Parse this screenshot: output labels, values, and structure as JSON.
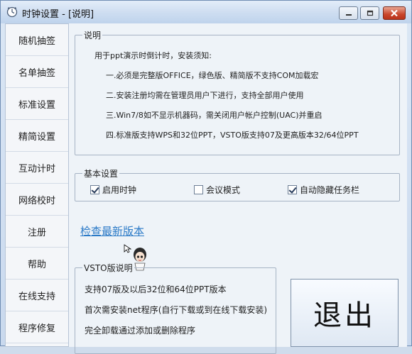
{
  "window": {
    "title": "时钟设置 - [说明]"
  },
  "sidebar": {
    "items": [
      {
        "label": "随机抽签"
      },
      {
        "label": "名单抽签"
      },
      {
        "label": "标准设置"
      },
      {
        "label": "精简设置"
      },
      {
        "label": "互动计时"
      },
      {
        "label": "网络校时"
      },
      {
        "label": "注册"
      },
      {
        "label": "帮助"
      },
      {
        "label": "在线支持"
      },
      {
        "label": "程序修复"
      }
    ]
  },
  "instructions": {
    "title": "说明",
    "intro": "用于ppt演示时倒计时，安装须知:",
    "lines": [
      "一.必须是完整版OFFICE，绿色版、精简版不支持COM加载宏",
      "二.安装注册均需在管理员用户下进行，支持全部用户使用",
      "三.Win7/8如不显示机器码，需关闭用户帐户控制(UAC)并重启",
      "四.标准版支持WPS和32位PPT，VSTO版支持07及更高版本32/64位PPT"
    ]
  },
  "basic_settings": {
    "title": "基本设置",
    "options": [
      {
        "label": "启用时钟",
        "checked": true
      },
      {
        "label": "会议模式",
        "checked": false
      },
      {
        "label": "自动隐藏任务栏",
        "checked": true
      }
    ]
  },
  "update_link": "检查最新版本",
  "vsto": {
    "title": "VSTO版说明",
    "lines": [
      "支持07版及以后32位和64位PPT版本",
      "首次需安装net程序(自行下载或到在线下载安装)",
      "完全卸载通过添加或删除程序"
    ]
  },
  "exit_button": "退出"
}
